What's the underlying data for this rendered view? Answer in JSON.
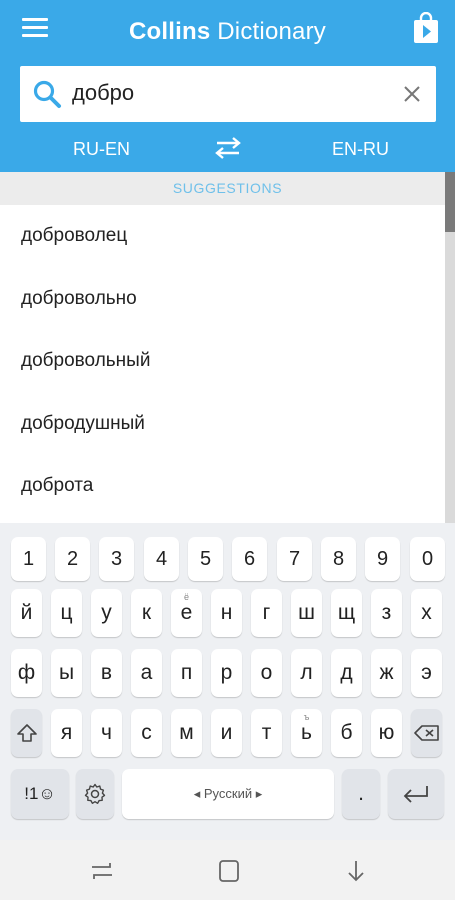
{
  "header": {
    "title_bold": "Collins",
    "title_rest": " Dictionary",
    "bg_color": "#3aa9e8",
    "menu_icon": "menu-icon",
    "store_icon": "play-store-bag-icon"
  },
  "search": {
    "value": "добро",
    "search_icon": "search-icon",
    "clear_icon": "close-icon"
  },
  "direction": {
    "left": "RU-EN",
    "right": "EN-RU",
    "swap_icon": "swap-arrows-icon"
  },
  "suggestions": {
    "header": "SUGGESTIONS",
    "items": [
      "доброволец",
      "добровольно",
      "добровольный",
      "добродушный",
      "доброта"
    ]
  },
  "keyboard": {
    "row_numbers": [
      "1",
      "2",
      "3",
      "4",
      "5",
      "6",
      "7",
      "8",
      "9",
      "0"
    ],
    "row1": [
      "й",
      "ц",
      "у",
      "к",
      "е",
      "н",
      "г",
      "ш",
      "щ",
      "з",
      "х"
    ],
    "row1_hint_e": "ё",
    "row2": [
      "ф",
      "ы",
      "в",
      "а",
      "п",
      "р",
      "о",
      "л",
      "д",
      "ж",
      "э"
    ],
    "row3": [
      "я",
      "ч",
      "с",
      "м",
      "и",
      "т",
      "ь",
      "б",
      "ю"
    ],
    "row3_hint_soft": "ъ",
    "symbols_label": "!1☺",
    "space_label": "◂ Русский ▸",
    "period_label": ".",
    "shift_icon": "shift-icon",
    "backspace_icon": "backspace-icon",
    "settings_icon": "gear-icon",
    "enter_icon": "enter-icon"
  },
  "navbar": {
    "recents_icon": "recents-icon",
    "home_icon": "home-icon",
    "back_icon": "back-icon"
  }
}
